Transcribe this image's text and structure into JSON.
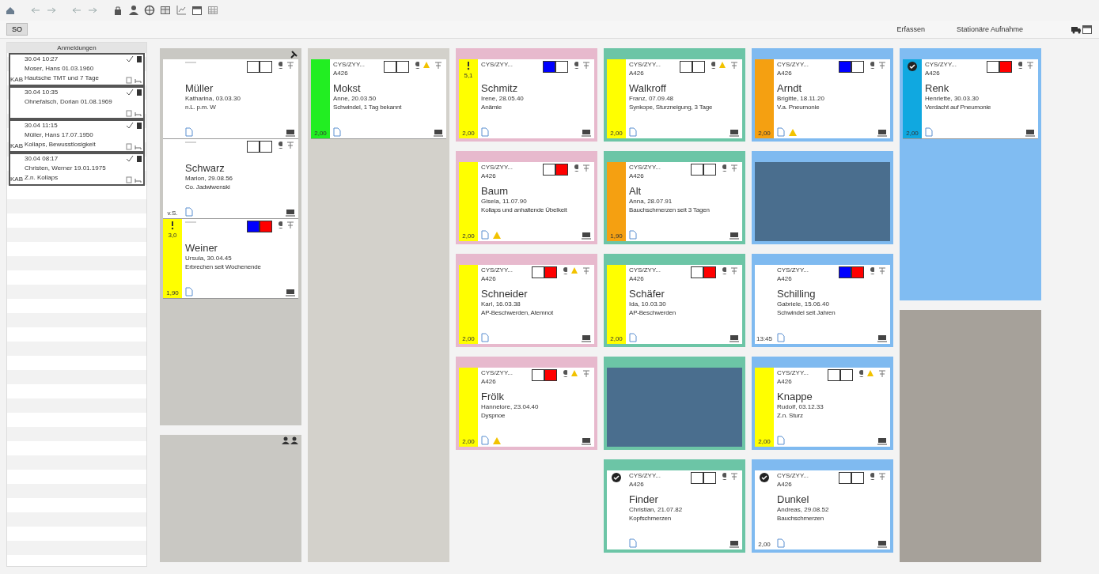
{
  "toolbar": {
    "tab": "SO",
    "links": [
      "Erfassen",
      "Stationäre Aufnahme"
    ]
  },
  "sidebar": {
    "title": "Anmeldungen",
    "entries": [
      {
        "time": "30.04 10:27",
        "name": "Moser, Hans 01.03.1960",
        "note": "Hautsche TMT und 7 Tage",
        "code": "KAB"
      },
      {
        "time": "30.04 10:35",
        "name": "Ohnefalsch, Dorian 01.08.1969"
      },
      {
        "time": "30.04 11:15",
        "name": "Müller, Hans 17.07.1950",
        "note": "Kollaps, Bewusstlosigkeit",
        "code": "KAB"
      },
      {
        "time": "30.04 08:17",
        "name": "Christen, Werner 19.01.1975",
        "note": "Z.n. Kollaps",
        "code": "KAB"
      }
    ]
  },
  "columns": [
    {
      "panels": [
        {
          "kind": "area",
          "color": "#c9c8c3",
          "pin": true,
          "patients": [
            {
              "name": "Müller",
              "born": "Katharina, 03.03.30",
              "note": "n.L. p.m. W",
              "squares": [
                {
                  "color": "#ffffff"
                },
                {
                  "color": "#ffffff"
                }
              ],
              "warning": false,
              "alert": false
            },
            {
              "name": "Schwarz",
              "born": "Marion, 29.08.56",
              "note": "Co. Jadwiwenski",
              "squares": [
                {
                  "color": "#ffffff"
                },
                {
                  "color": "#ffffff"
                }
              ],
              "warning": false,
              "alert": false,
              "tag": "v.S."
            },
            {
              "name": "Weiner",
              "born": "Ursula, 30.04.45",
              "note": "Erbrechen seit Wochenende",
              "squares": [
                {
                  "color": "#0000ff"
                },
                {
                  "color": "#ff0000"
                }
              ],
              "warning": false,
              "alert": false,
              "stripe": {
                "color": "#ffff00"
              },
              "score": "3,0",
              "tag": "1,90"
            }
          ]
        },
        {
          "kind": "area",
          "color": "#c9c8c3",
          "people": true
        }
      ]
    },
    {
      "panels": [
        {
          "kind": "area",
          "color": "#d3d1cb",
          "patients": [
            {
              "code": "CYS/ZYY...",
              "room": "A426",
              "name": "Mokst",
              "born": "Anne, 20.03.50",
              "note": "Schwindel, 1 Tag bekannt",
              "squares": [
                {
                  "color": "#ffffff"
                },
                {
                  "color": "#ffffff"
                }
              ],
              "warning": true,
              "alert": false,
              "stripe": {
                "color": "#22ee22"
              },
              "tag": "2,00"
            }
          ]
        }
      ]
    },
    {
      "panels": [
        {
          "kind": "room",
          "color": "#e7b9cd",
          "patient": {
            "code": "CYS/ZYY...",
            "name": "Schmitz",
            "born": "Irene, 28.05.40",
            "note": "Anämie",
            "squares": [
              {
                "color": "#0000ff"
              },
              {
                "color": "#ffffff"
              }
            ],
            "warning": false,
            "alert": false,
            "stripe": {
              "color": "#ffff00"
            },
            "score": "5,1",
            "tag": "2,00"
          }
        },
        {
          "kind": "room",
          "color": "#e7b9cd",
          "patient": {
            "code": "CYS/ZYY...",
            "room": "A426",
            "name": "Baum",
            "born": "Gisela, 11.07.90",
            "note": "Kollaps und anhaltende Übelkeit",
            "squares": [
              {
                "color": "#ffffff"
              },
              {
                "color": "#ff0000"
              }
            ],
            "warning": false,
            "alert": true,
            "stripe": {
              "color": "#ffff00"
            },
            "tag": "2,00"
          }
        },
        {
          "kind": "room",
          "color": "#e7b9cd",
          "patient": {
            "code": "CYS/ZYY...",
            "room": "A426",
            "name": "Schneider",
            "born": "Karl, 16.03.38",
            "note": "AP-Beschwerden, Atemnot",
            "squares": [
              {
                "color": "#ffffff"
              },
              {
                "color": "#ff0000"
              }
            ],
            "warning": true,
            "alert": false,
            "stripe": {
              "color": "#ffff00"
            },
            "tag": "2,00"
          }
        },
        {
          "kind": "room",
          "color": "#e7b9cd",
          "patient": {
            "code": "CYS/ZYY...",
            "room": "A426",
            "name": "Frölk",
            "born": "Hannelore, 23.04.40",
            "note": "Dyspnoe",
            "squares": [
              {
                "color": "#ffffff"
              },
              {
                "color": "#ff0000"
              }
            ],
            "warning": true,
            "alert": true,
            "stripe": {
              "color": "#ffff00"
            },
            "tag": "2,00"
          }
        }
      ]
    },
    {
      "panels": [
        {
          "kind": "room",
          "color": "#6cc5a6",
          "patient": {
            "code": "CYS/ZYY...",
            "room": "A426",
            "name": "Walkroff",
            "born": "Franz, 07.09.48",
            "note": "Synkope, Sturzneigung, 3 Tage",
            "squares": [
              {
                "color": "#ffffff"
              },
              {
                "color": "#ffffff"
              }
            ],
            "warning": true,
            "alert": false,
            "stripe": {
              "color": "#ffff00"
            },
            "tag": "2,00"
          }
        },
        {
          "kind": "room",
          "color": "#6cc5a6",
          "patient": {
            "code": "CYS/ZYY...",
            "room": "A426",
            "name": "Alt",
            "born": "Anna, 28.07.91",
            "note": "Bauchschmerzen seit 3 Tagen",
            "squares": [
              {
                "color": "#ffffff"
              },
              {
                "color": "#ffffff"
              }
            ],
            "warning": false,
            "alert": false,
            "stripe": {
              "color": "#f5a011"
            },
            "tag": "1,90"
          }
        },
        {
          "kind": "room",
          "color": "#6cc5a6",
          "patient": {
            "code": "CYS/ZYY...",
            "room": "A426",
            "name": "Schäfer",
            "born": "Ida, 10.03.30",
            "note": "AP-Beschwerden",
            "squares": [
              {
                "color": "#ffffff"
              },
              {
                "color": "#ff0000"
              }
            ],
            "warning": false,
            "alert": false,
            "stripe": {
              "color": "#ffff00"
            },
            "tag": "2,00"
          }
        },
        {
          "kind": "empty",
          "color": "#6cc5a6"
        },
        {
          "kind": "room",
          "color": "#6cc5a6",
          "patient": {
            "code": "CYS/ZYY...",
            "room": "A426",
            "name": "Finder",
            "born": "Christian, 21.07.82",
            "note": "Kopfschmerzen",
            "squares": [
              {
                "color": "#ffffff"
              },
              {
                "color": "#ffffff"
              }
            ],
            "warning": false,
            "alert": false,
            "done": true
          }
        }
      ]
    },
    {
      "panels": [
        {
          "kind": "room",
          "color": "#7fbaf0",
          "patient": {
            "code": "CYS/ZYY...",
            "room": "A426",
            "name": "Arndt",
            "born": "Brigitte, 18.11.20",
            "note": "V.a. Pneumonie",
            "squares": [
              {
                "color": "#0000ff"
              },
              {
                "color": "#ffffff"
              }
            ],
            "warning": false,
            "alert": true,
            "stripe": {
              "color": "#f5a011"
            },
            "tag": "2,00"
          }
        },
        {
          "kind": "empty",
          "color": "#7fbaf0"
        },
        {
          "kind": "room",
          "color": "#7fbaf0",
          "patient": {
            "code": "CYS/ZYY...",
            "room": "A426",
            "name": "Schilling",
            "born": "Gabriele, 15.06.40",
            "note": "Schwindel seit Jahren",
            "squares": [
              {
                "color": "#0000ff"
              },
              {
                "color": "#ff0000"
              }
            ],
            "warning": false,
            "alert": false,
            "tag": "13:45"
          }
        },
        {
          "kind": "room",
          "color": "#7fbaf0",
          "patient": {
            "code": "CYS/ZYY...",
            "room": "A426",
            "name": "Knappe",
            "born": "Rudolf, 03.12.33",
            "note": "Z.n. Sturz",
            "squares": [
              {
                "color": "#ffffff"
              },
              {
                "color": "#ffffff"
              }
            ],
            "warning": true,
            "alert": false,
            "stripe": {
              "color": "#ffff00"
            },
            "tag": "2,00"
          }
        },
        {
          "kind": "room",
          "color": "#7fbaf0",
          "patient": {
            "code": "CYS/ZYY...",
            "room": "A426",
            "name": "Dunkel",
            "born": "Andreas, 29.08.52",
            "note": "Bauchschmerzen",
            "squares": [
              {
                "color": "#ffffff"
              },
              {
                "color": "#ffffff"
              }
            ],
            "warning": false,
            "alert": false,
            "done": true,
            "tag": "2,00"
          }
        }
      ]
    },
    {
      "panels": [
        {
          "kind": "area",
          "color": "#80bcf2",
          "patients": [
            {
              "code": "CYS/ZYY...",
              "room": "A426",
              "name": "Renk",
              "born": "Henriette, 30.03.30",
              "note": "Verdacht auf Pneumonie",
              "squares": [
                {
                  "color": "#ffffff"
                },
                {
                  "color": "#ff0000"
                }
              ],
              "warning": false,
              "alert": false,
              "stripe": {
                "color": "#10a8e0"
              },
              "done": true,
              "tag": "2,00"
            }
          ]
        },
        {
          "kind": "area",
          "color": "#a6a19a"
        }
      ]
    }
  ]
}
